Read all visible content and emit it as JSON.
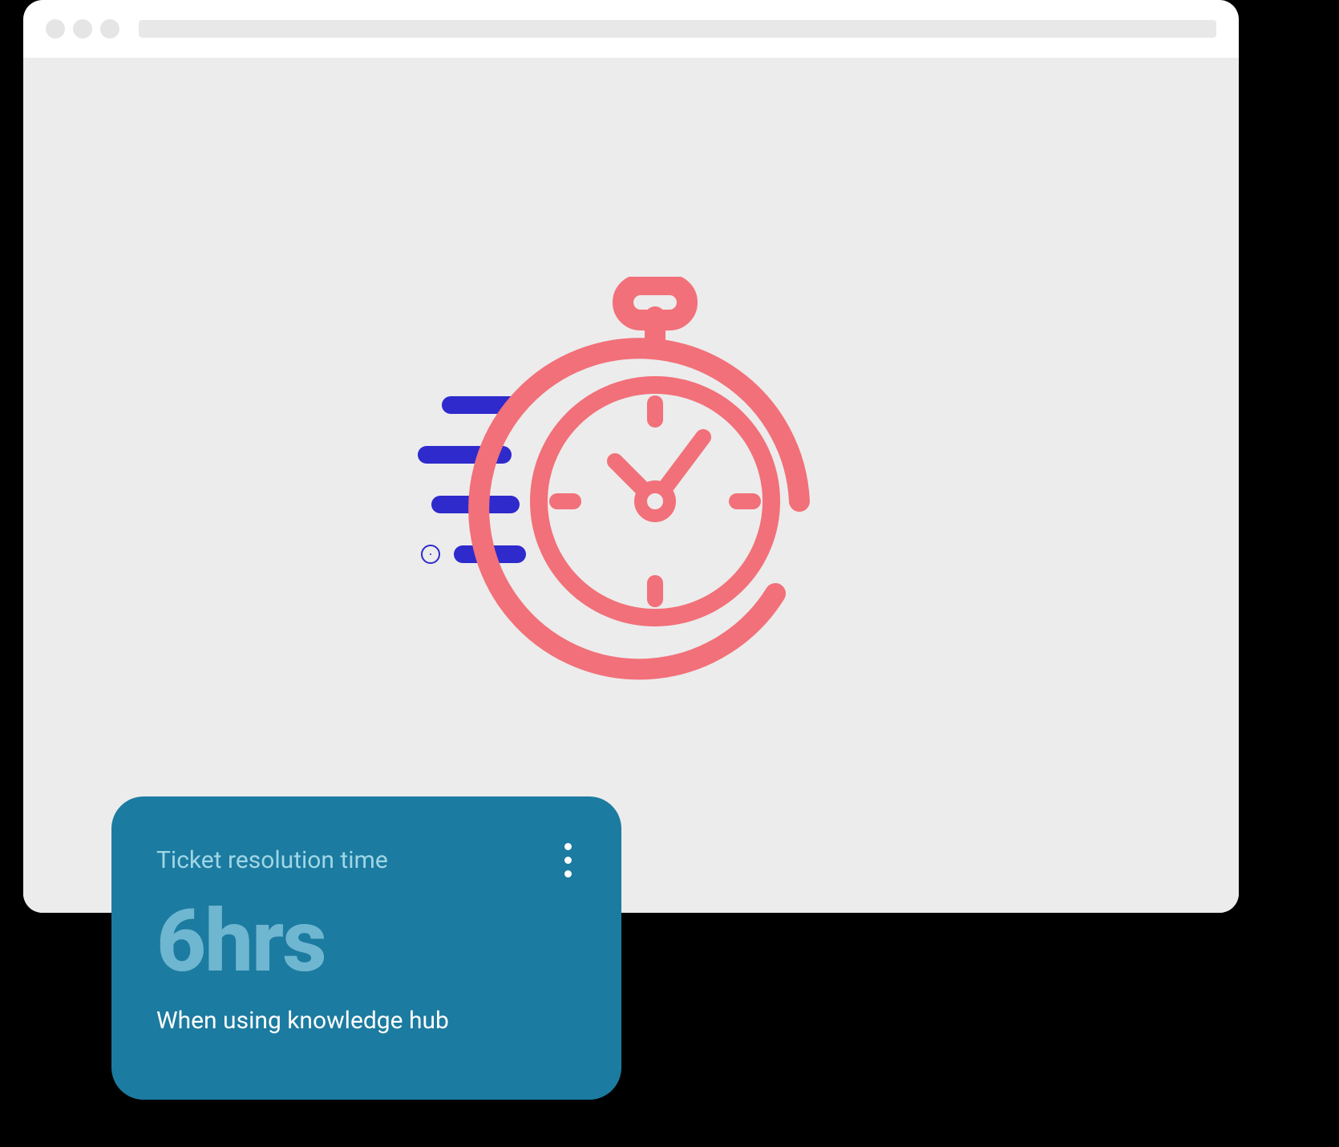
{
  "icons": {
    "stopwatch": "stopwatch-icon",
    "kebab": "more-icon"
  },
  "colors": {
    "stopwatch": "#f27079",
    "speedlines": "#2f2acc",
    "card_bg": "#1c7ba0",
    "card_title": "#9fd6e6",
    "card_value": "#6fb6d0"
  },
  "card": {
    "title": "Ticket resolution time",
    "value": "6hrs",
    "subtitle": "When using knowledge hub"
  }
}
